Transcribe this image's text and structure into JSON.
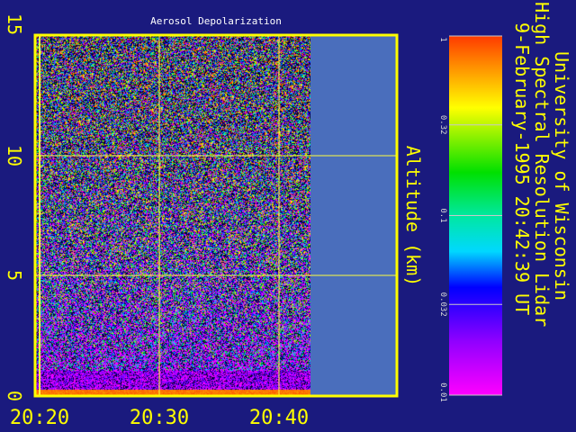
{
  "chart_data": {
    "type": "heatmap",
    "title": "Aerosol Depolarization",
    "ylabel": "Altitude (km)",
    "xlabel": "",
    "ylim": [
      0,
      15
    ],
    "y_ticks": [
      "0",
      "5",
      "10",
      "15"
    ],
    "x_ticks": [
      "20:20",
      "20:30",
      "20:40"
    ],
    "grid": true,
    "colorbar": {
      "scale": "log",
      "range": [
        0.01,
        1
      ],
      "tick_labels": [
        "1",
        "0.32",
        "0.1",
        "0.032",
        "0.01"
      ]
    }
  },
  "header": {
    "lines": [
      "University of Wisconsin",
      "High Spectral Resolution Lidar",
      "9-February-1995 20:42:39 UT"
    ]
  },
  "colors": {
    "background": "#1a1a7e",
    "axis": "#ffff00",
    "no_data": "#4a6ebc"
  }
}
